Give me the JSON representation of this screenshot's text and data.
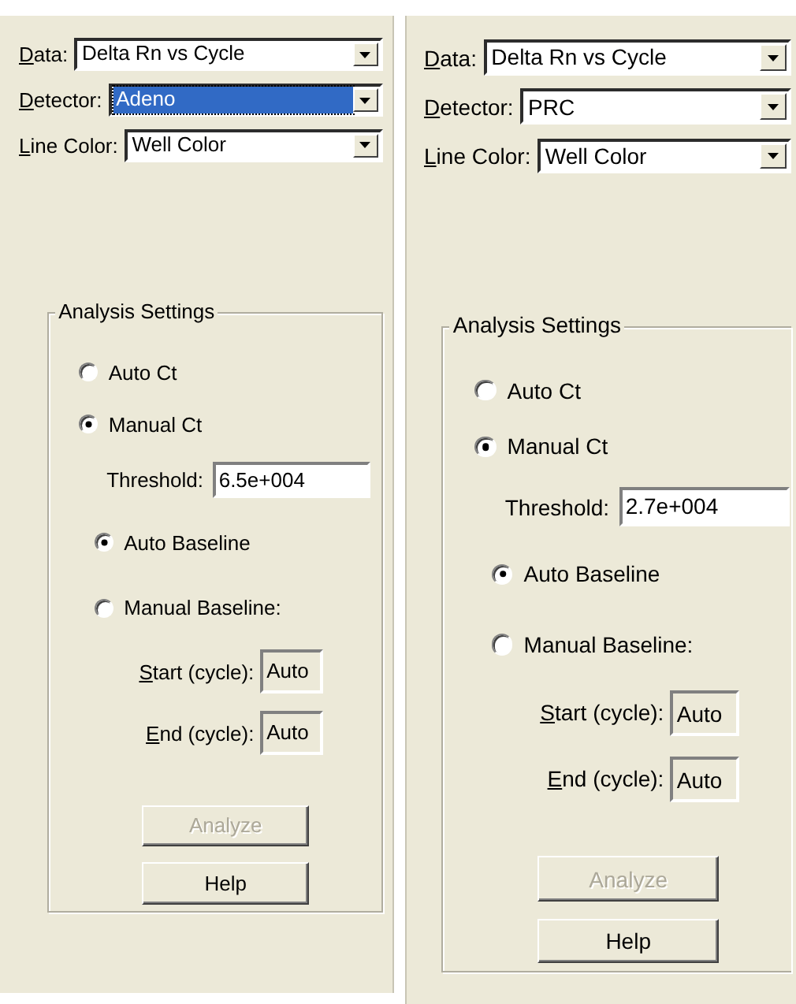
{
  "panels": [
    {
      "fields": [
        {
          "label": "Data:",
          "value": "Delta Rn vs Cycle",
          "focused": false
        },
        {
          "label": "Detector:",
          "value": "Adeno",
          "focused": true
        },
        {
          "label": "Line Color:",
          "value": "Well Color",
          "focused": false
        }
      ],
      "group": {
        "title": "Analysis Settings",
        "ct_options": [
          {
            "label": "Auto Ct",
            "selected": false
          },
          {
            "label": "Manual Ct",
            "selected": true
          }
        ],
        "threshold": {
          "label": "Threshold:",
          "value": "6.5e+004"
        },
        "baseline_options": [
          {
            "label": "Auto Baseline",
            "selected": true
          },
          {
            "label": "Manual Baseline:",
            "selected": false
          }
        ],
        "cycle_fields": [
          {
            "label": "Start (cycle):",
            "value": "Auto"
          },
          {
            "label": "End (cycle):",
            "value": "Auto"
          }
        ],
        "buttons": [
          {
            "label": "Analyze",
            "disabled": true
          },
          {
            "label": "Help",
            "disabled": false
          }
        ]
      }
    },
    {
      "fields": [
        {
          "label": "Data:",
          "value": "Delta Rn vs Cycle",
          "focused": false
        },
        {
          "label": "Detector:",
          "value": "PRC",
          "focused": false
        },
        {
          "label": "Line Color:",
          "value": "Well Color",
          "focused": false
        }
      ],
      "group": {
        "title": "Analysis Settings",
        "ct_options": [
          {
            "label": "Auto Ct",
            "selected": false
          },
          {
            "label": "Manual Ct",
            "selected": true
          }
        ],
        "threshold": {
          "label": "Threshold:",
          "value": "2.7e+004"
        },
        "baseline_options": [
          {
            "label": "Auto Baseline",
            "selected": true
          },
          {
            "label": "Manual Baseline:",
            "selected": false
          }
        ],
        "cycle_fields": [
          {
            "label": "Start (cycle):",
            "value": "Auto"
          },
          {
            "label": "End (cycle):",
            "value": "Auto"
          }
        ],
        "buttons": [
          {
            "label": "Analyze",
            "disabled": true
          },
          {
            "label": "Help",
            "disabled": false
          }
        ]
      }
    }
  ]
}
